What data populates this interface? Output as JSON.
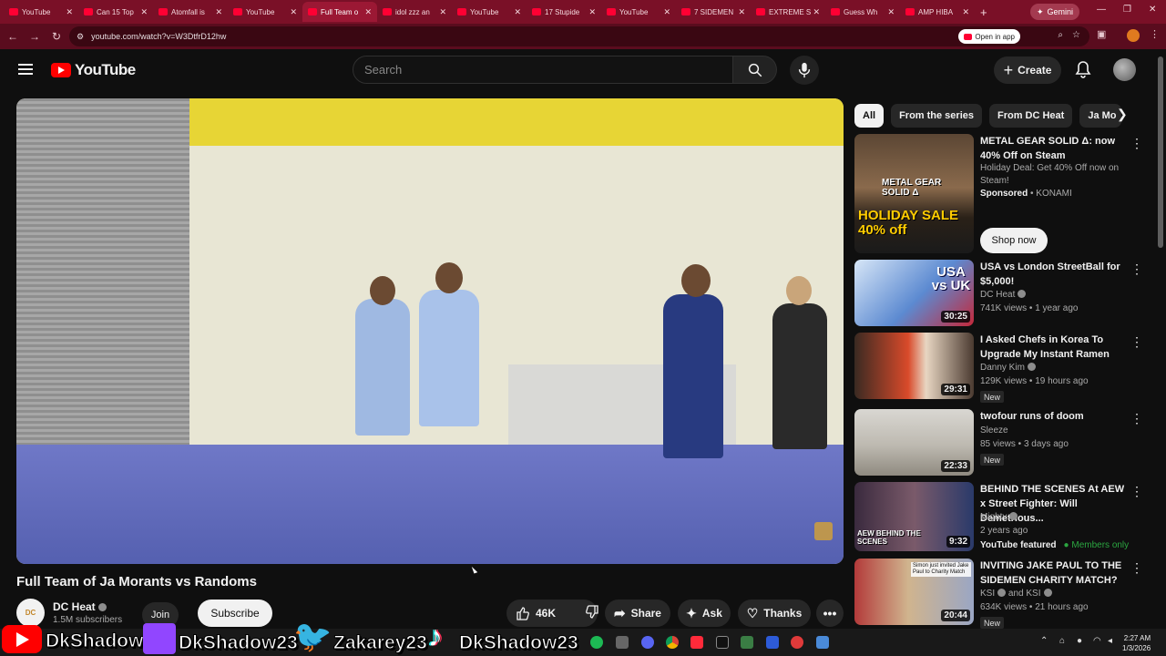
{
  "browser": {
    "tabs": [
      {
        "label": "YouTube"
      },
      {
        "label": "Can 15 Top"
      },
      {
        "label": "Atomfall is"
      },
      {
        "label": "YouTube"
      },
      {
        "label": "Full Team o"
      },
      {
        "label": "idol zzz an"
      },
      {
        "label": "YouTube"
      },
      {
        "label": "17 Stupide"
      },
      {
        "label": "YouTube"
      },
      {
        "label": "7 SIDEMEN"
      },
      {
        "label": "EXTREME S"
      },
      {
        "label": "Guess Wh"
      },
      {
        "label": "AMP HIBA"
      }
    ],
    "gemini_label": "Gemini",
    "url": "youtube.com/watch?v=W3DtfrD12hw",
    "open_in_app": "Open in app"
  },
  "header": {
    "logo_text": "YouTube",
    "search_placeholder": "Search",
    "create_label": "Create"
  },
  "video": {
    "title": "Full Team of Ja Morants vs Randoms",
    "channel": "DC Heat",
    "channel_avatar_text": "DC",
    "subscribers": "1.5M subscribers",
    "join_label": "Join",
    "subscribe_label": "Subscribe",
    "likes": "46K",
    "share_label": "Share",
    "ask_label": "Ask",
    "thanks_label": "Thanks"
  },
  "chips": [
    "All",
    "From the series",
    "From DC Heat",
    "Ja Mo"
  ],
  "recommendations": [
    {
      "title": "METAL GEAR SOLID Δ: now 40% Off on Steam",
      "line1": "Holiday Deal: Get 40% Off now on Steam!",
      "sponsor": "Sponsored",
      "advertiser": "KONAMI",
      "cta": "Shop now",
      "thumb_text": "METAL GEAR SOLID Δ",
      "thumb_sale": "HOLIDAY SALE 40% off"
    },
    {
      "title": "USA vs London StreetBall for $5,000!",
      "channel": "DC Heat",
      "meta": "741K views • 1 year ago",
      "duration": "30:25",
      "thumb_text": "USA vs UK"
    },
    {
      "title": "I Asked Chefs in Korea To Upgrade My Instant Ramen",
      "channel": "Danny Kim",
      "meta": "129K views • 19 hours ago",
      "duration": "29:31",
      "badge": "New"
    },
    {
      "title": "twofour runs of doom",
      "channel": "Sleeze",
      "meta": "85 views • 3 days ago",
      "duration": "22:33",
      "badge": "New"
    },
    {
      "title": "BEHIND THE SCENES At AEW x Street Fighter: Will Demetrious...",
      "channel": "Mighty",
      "meta": "2 years ago",
      "duration": "9:32",
      "featured": "YouTube featured",
      "members": "Members only",
      "thumb_text": "AEW BEHIND THE SCENES"
    },
    {
      "title": "INVITING JAKE PAUL TO THE SIDEMEN CHARITY MATCH?",
      "channel": "KSI",
      "channel_suffix": "and KSI",
      "meta": "634K views • 21 hours ago",
      "duration": "20:44",
      "badge": "New",
      "thumb_text": "Simon just invited Jake Paul to Charity Match"
    }
  ],
  "overlay": {
    "handle1": "DkShadow",
    "handle2": "DkShadow23",
    "handle3": "Zakarey23",
    "handle4": "DkShadow23"
  },
  "taskbar": {
    "time": "2:27 AM",
    "date": "1/3/2026"
  },
  "colors": {
    "background": "#0f0f0f",
    "browser_frame": "#7a1027",
    "youtube_red": "#ff0000"
  }
}
